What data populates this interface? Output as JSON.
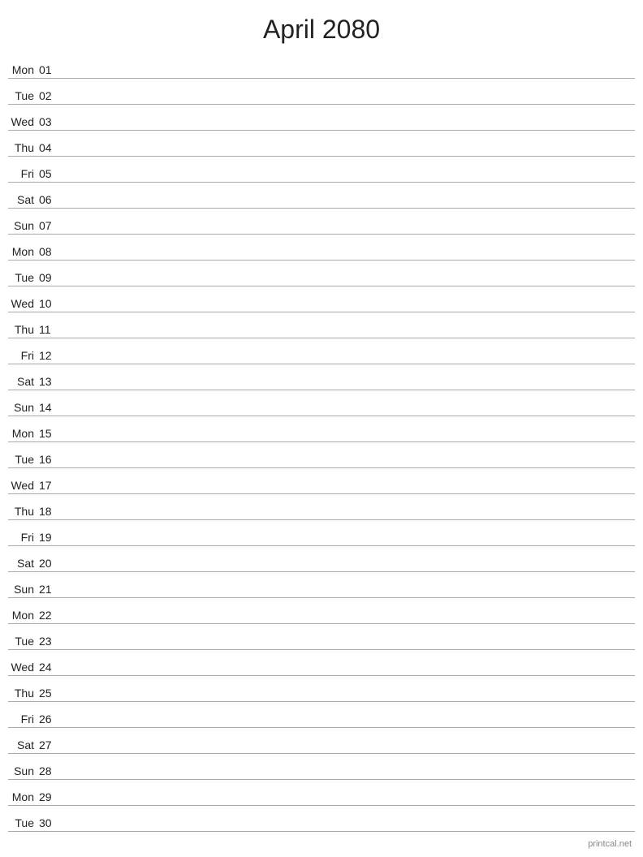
{
  "title": "April 2080",
  "footer": "printcal.net",
  "days": [
    {
      "name": "Mon",
      "num": "01"
    },
    {
      "name": "Tue",
      "num": "02"
    },
    {
      "name": "Wed",
      "num": "03"
    },
    {
      "name": "Thu",
      "num": "04"
    },
    {
      "name": "Fri",
      "num": "05"
    },
    {
      "name": "Sat",
      "num": "06"
    },
    {
      "name": "Sun",
      "num": "07"
    },
    {
      "name": "Mon",
      "num": "08"
    },
    {
      "name": "Tue",
      "num": "09"
    },
    {
      "name": "Wed",
      "num": "10"
    },
    {
      "name": "Thu",
      "num": "11"
    },
    {
      "name": "Fri",
      "num": "12"
    },
    {
      "name": "Sat",
      "num": "13"
    },
    {
      "name": "Sun",
      "num": "14"
    },
    {
      "name": "Mon",
      "num": "15"
    },
    {
      "name": "Tue",
      "num": "16"
    },
    {
      "name": "Wed",
      "num": "17"
    },
    {
      "name": "Thu",
      "num": "18"
    },
    {
      "name": "Fri",
      "num": "19"
    },
    {
      "name": "Sat",
      "num": "20"
    },
    {
      "name": "Sun",
      "num": "21"
    },
    {
      "name": "Mon",
      "num": "22"
    },
    {
      "name": "Tue",
      "num": "23"
    },
    {
      "name": "Wed",
      "num": "24"
    },
    {
      "name": "Thu",
      "num": "25"
    },
    {
      "name": "Fri",
      "num": "26"
    },
    {
      "name": "Sat",
      "num": "27"
    },
    {
      "name": "Sun",
      "num": "28"
    },
    {
      "name": "Mon",
      "num": "29"
    },
    {
      "name": "Tue",
      "num": "30"
    }
  ]
}
